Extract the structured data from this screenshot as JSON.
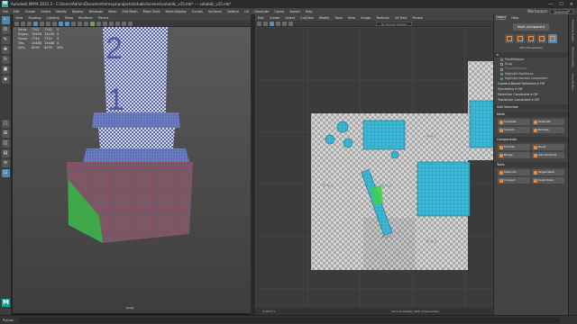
{
  "window": {
    "title": "Autodesk MAYA 2022.3 - C:\\Users\\Admin\\Documents\\maya\\projects\\lotubiki\\scenes\\votubiki_v15.mb* --- votubiki_v15.mb*",
    "minimize": "—",
    "maximize": "☐",
    "close": "✕"
  },
  "menubar": {
    "items": [
      "File",
      "Edit",
      "Create",
      "Select",
      "Modify",
      "Display",
      "Windows",
      "Mesh",
      "Edit Mesh",
      "Mesh Tools",
      "Mesh Display",
      "Curves",
      "Surfaces",
      "Deform",
      "UV",
      "Generate",
      "Cache",
      "Arnold",
      "Help"
    ],
    "workspace_label": "Workspace:",
    "workspace_value": "General*"
  },
  "viewport": {
    "menu": [
      "View",
      "Shading",
      "Lighting",
      "Show",
      "Renderer",
      "Panels"
    ],
    "hud": {
      "rows": [
        {
          "label": "Verts:",
          "a": "7762",
          "b": "7762",
          "c": "0"
        },
        {
          "label": "Edges:",
          "a": "15456",
          "b": "15456",
          "c": "0"
        },
        {
          "label": "Faces:",
          "a": "7744",
          "b": "7744",
          "c": "0"
        },
        {
          "label": "Tris:",
          "a": "15488",
          "b": "15488",
          "c": "0"
        },
        {
          "label": "UVs:",
          "a": "8259",
          "b": "8259",
          "c": "283"
        }
      ]
    },
    "camera_label": "persp",
    "digits": [
      "2",
      "1"
    ]
  },
  "uv_editor": {
    "menu": [
      "Edit",
      "Create",
      "Select",
      "Cut/Sew",
      "Modify",
      "Tools",
      "View",
      "Image",
      "Textures",
      "UV Sets",
      "Panels"
    ],
    "uvset_label": "No Overall Shaded",
    "status_left": "0.347  0.1",
    "status_right": "(UV) UV shell(s), 283 component(s)",
    "tile_labels": [
      "5-4-1",
      "4-4-1",
      "5-4-1",
      "4-4-1",
      "4-4-1"
    ]
  },
  "toolkit": {
    "tabs": [
      "Object",
      "Help"
    ],
    "header_button": "Multi-Component",
    "info": "283 UVs selected",
    "selection_options": [
      {
        "label": "Pick/Marquee",
        "checked": true
      },
      {
        "label": "Drag",
        "checked": false
      },
      {
        "label": "Tweak/Marquee",
        "checked": false,
        "dim": true
      },
      {
        "label": "Highlight Backfaces",
        "checked": true
      },
      {
        "label": "Highlight Nearest Component",
        "checked": true
      }
    ],
    "camera_based": "Camera-Based Selection  ▾  Off",
    "symmetry": "Symmetry  ▾  Off",
    "selection_constraint": "Selection Constraint  ▾  Off",
    "transform_constraint": "Transform Constraint  ▾  Off",
    "soft_selection": "Soft Selection",
    "mesh_header": "Mesh",
    "mesh_buttons": [
      "Combine",
      "Separate",
      "Smooth",
      "Boolean"
    ],
    "components_header": "Components",
    "components_buttons": [
      "Extrude",
      "Bevel",
      "Bridge",
      "Add Divisions"
    ],
    "tools_header": "Tools",
    "tools_buttons": [
      "Multi-Cut",
      "Target Weld",
      "Connect",
      "Quad Draw"
    ],
    "vtabs": [
      "Modeling Toolkit",
      "Attribute Editor",
      "Channel Box"
    ]
  },
  "statusbar": {
    "label": "Python"
  }
}
